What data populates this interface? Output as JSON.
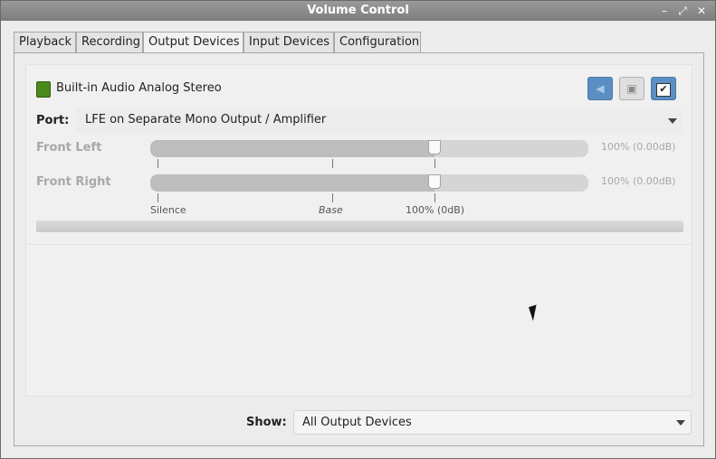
{
  "window": {
    "title": "Volume Control",
    "controls": {
      "minimize": "–",
      "maximize": "⤢",
      "close": "✕"
    }
  },
  "tabs": [
    {
      "label": "Playback",
      "active": false
    },
    {
      "label": "Recording",
      "active": false
    },
    {
      "label": "Output Devices",
      "active": true
    },
    {
      "label": "Input Devices",
      "active": false
    },
    {
      "label": "Configuration",
      "active": false
    }
  ],
  "device": {
    "name": "Built-in Audio Analog Stereo",
    "icon": "audio-card-icon",
    "buttons": {
      "mute": "mute-icon",
      "lock": "lock-icon",
      "default": "check-icon"
    },
    "port_label": "Port:",
    "port_value": "LFE on Separate Mono Output / Amplifier",
    "channels": [
      {
        "name": "Front Left",
        "value": "100% (0.00dB)",
        "level": 0.65
      },
      {
        "name": "Front Right",
        "value": "100% (0.00dB)",
        "level": 0.65
      }
    ],
    "scale": {
      "silence": "Silence",
      "base": "Base",
      "norm": "100% (0dB)"
    },
    "peak_level": 0
  },
  "footer": {
    "show_label": "Show:",
    "show_value": "All Output Devices"
  },
  "colors": {
    "accent": "#5b8fc4",
    "titlebar": "#8a8a8a"
  }
}
